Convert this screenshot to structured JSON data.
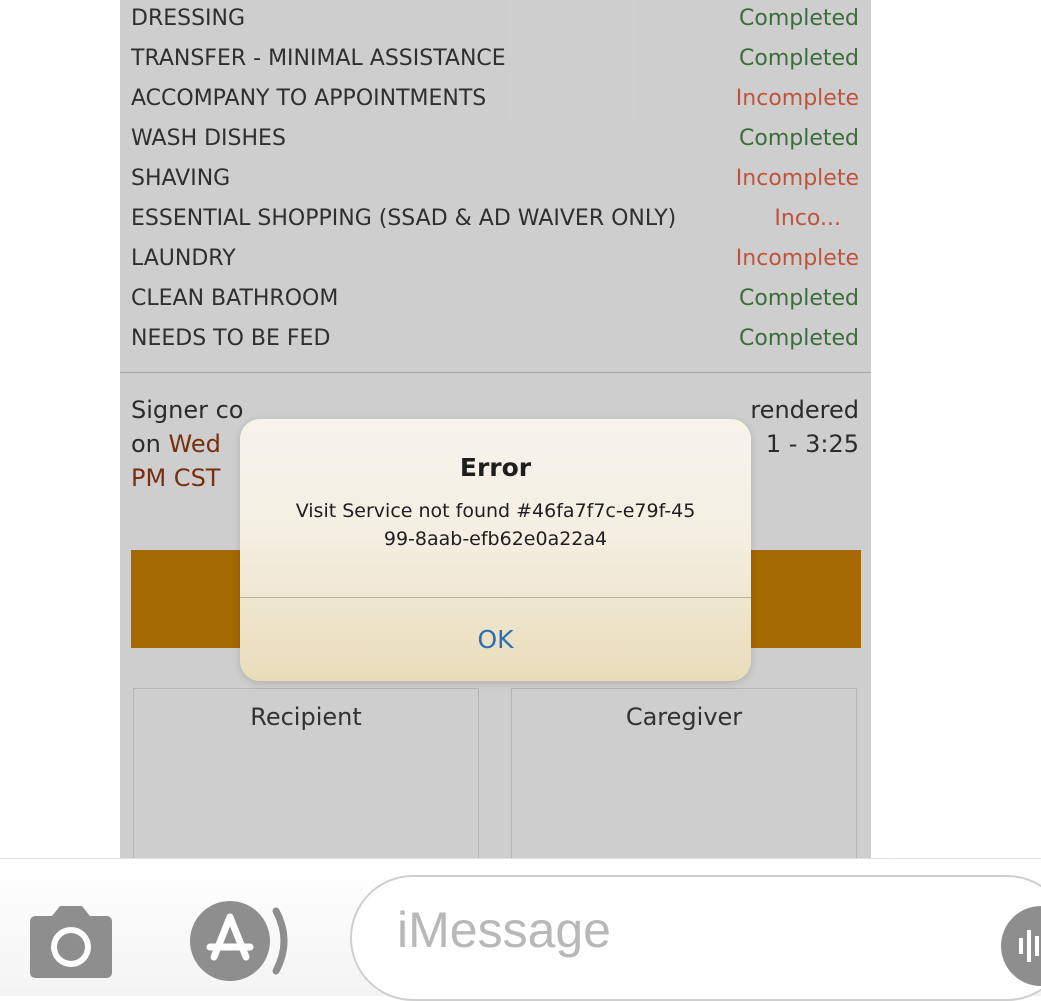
{
  "services": [
    {
      "name": "DRESSING",
      "status": "Completed",
      "state": "completed"
    },
    {
      "name": "TRANSFER - MINIMAL ASSISTANCE",
      "status": "Completed",
      "state": "completed"
    },
    {
      "name": "ACCOMPANY TO APPOINTMENTS",
      "status": "Incomplete",
      "state": "incomplete"
    },
    {
      "name": "WASH DISHES",
      "status": "Completed",
      "state": "completed"
    },
    {
      "name": "SHAVING",
      "status": "Incomplete",
      "state": "incomplete"
    },
    {
      "name": "ESSENTIAL SHOPPING (SSAD & AD WAIVER ONLY)",
      "status": "Inco...",
      "state": "incomplete"
    },
    {
      "name": "LAUNDRY",
      "status": "Incomplete",
      "state": "incomplete"
    },
    {
      "name": "CLEAN BATHROOM",
      "status": "Completed",
      "state": "completed"
    },
    {
      "name": "NEEDS TO BE FED",
      "status": "Completed",
      "state": "completed"
    }
  ],
  "signer": {
    "line1": "Signer co",
    "line1_end": "rendered",
    "line2_prefix": "on ",
    "line2_date": "Wed",
    "line2_end": "1 - 3:25",
    "line3": "PM CST"
  },
  "signature": {
    "recipient_label": "Recipient",
    "caregiver_label": "Caregiver"
  },
  "alert": {
    "title": "Error",
    "message": "Visit Service not found #46fa7f7c-e79f-4599-8aab-efb62e0a22a4",
    "ok_label": "OK"
  },
  "message_bar": {
    "placeholder": "iMessage"
  },
  "colors": {
    "completed": "#3e6f3d",
    "incomplete": "#c3563f",
    "action_bar": "#a86d00",
    "alert_button": "#2a6fb5"
  },
  "icons": [
    "camera-icon",
    "app-store-icon",
    "audio-waveform-icon"
  ]
}
